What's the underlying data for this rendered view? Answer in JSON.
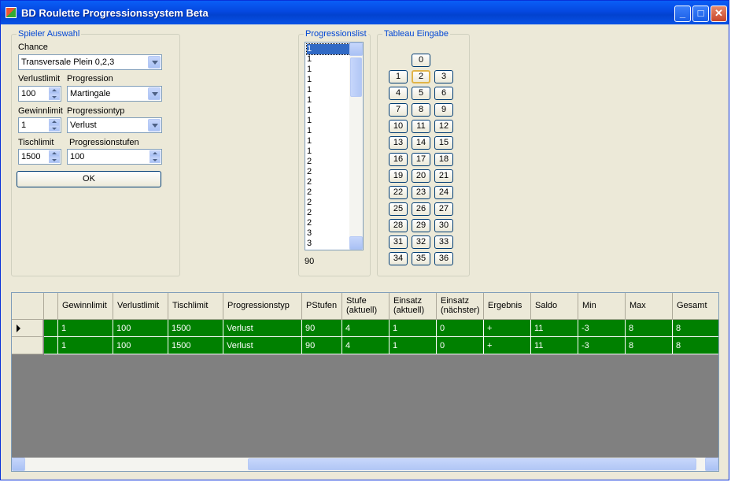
{
  "window": {
    "title": "BD Roulette Progressionssystem Beta"
  },
  "spieler": {
    "group_title": "Spieler Auswahl",
    "chance_label": "Chance",
    "chance_value": "Transversale Plein 0,2,3",
    "verlustlimit_label": "Verlustlimit",
    "verlustlimit_value": "100",
    "progression_label": "Progression",
    "progression_value": "Martingale",
    "gewinnlimit_label": "Gewinnlimit",
    "gewinnlimit_value": "1",
    "progressiontyp_label": "Progressiontyp",
    "progressiontyp_value": "Verlust",
    "tischlimit_label": "Tischlimit",
    "tischlimit_value": "1500",
    "progressionstufen_label": "Progressionstufen",
    "progressionstufen_value": "100",
    "ok_label": "OK"
  },
  "progressionslist": {
    "group_title": "Progressionslist",
    "items": [
      "1",
      "1",
      "1",
      "1",
      "1",
      "1",
      "1",
      "1",
      "1",
      "1",
      "1",
      "2",
      "2",
      "2",
      "2",
      "2",
      "2",
      "2",
      "3",
      "3",
      "3"
    ],
    "count": "90"
  },
  "tableau": {
    "group_title": "Tableau Eingabe",
    "zero": "0",
    "numbers": [
      "1",
      "2",
      "3",
      "4",
      "5",
      "6",
      "7",
      "8",
      "9",
      "10",
      "11",
      "12",
      "13",
      "14",
      "15",
      "16",
      "17",
      "18",
      "19",
      "20",
      "21",
      "22",
      "23",
      "24",
      "25",
      "26",
      "27",
      "28",
      "29",
      "30",
      "31",
      "32",
      "33",
      "34",
      "35",
      "36"
    ]
  },
  "grid": {
    "columns": [
      "Gewinnlimit",
      "Verlustlimit",
      "Tischlimit",
      "Progressionstyp",
      "PStufen",
      "Stufe\n(aktuell)",
      "Einsatz\n(aktuell)",
      "Einsatz\n(nächster)",
      "Ergebnis",
      "Saldo",
      "Min",
      "Max",
      "Gesamt"
    ],
    "rows": [
      [
        "1",
        "100",
        "1500",
        "Verlust",
        "90",
        "4",
        "1",
        "0",
        "+",
        "11",
        "-3",
        "8",
        "8"
      ],
      [
        "1",
        "100",
        "1500",
        "Verlust",
        "90",
        "4",
        "1",
        "0",
        "+",
        "11",
        "-3",
        "8",
        "8"
      ]
    ]
  },
  "colors": {
    "row_bg": "#008000",
    "group_title": "#0046d5",
    "titlebar": "#0a5ef7"
  },
  "icons": {
    "minimize": "minimize-icon",
    "maximize": "maximize-icon",
    "close": "close-icon"
  }
}
